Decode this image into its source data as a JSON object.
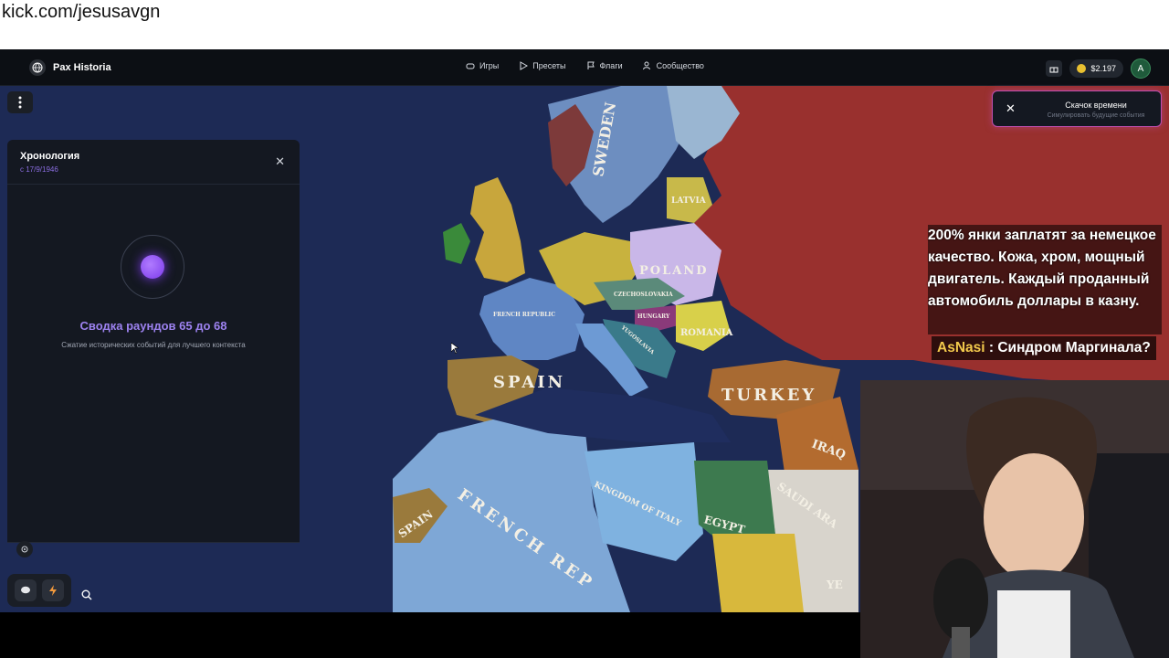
{
  "stream": {
    "url": "kick.com/jesusavgn"
  },
  "header": {
    "brand": "Pax Historia",
    "nav": [
      {
        "label": "Игры",
        "icon": "gamepad-icon"
      },
      {
        "label": "Пресеты",
        "icon": "play-icon"
      },
      {
        "label": "Флаги",
        "icon": "flag-icon"
      },
      {
        "label": "Сообщество",
        "icon": "users-icon"
      }
    ],
    "balance": "$2.197",
    "avatar": "A"
  },
  "timeline": {
    "title": "Хронология",
    "date": "с 17/9/1946",
    "summary": "Сводка раундов 65 до 68",
    "subtitle": "Сжатие исторических событий для лучшего контекста"
  },
  "timeleap": {
    "title": "Скачок времени",
    "subtitle": "Симулировать будущие события"
  },
  "overlay": {
    "donation": "200% янки заплатят за немецкое качество. Кожа, хром, мощный двигатель. Каждый проданный автомобиль доллары в казну.",
    "chat_user": "AsNasi",
    "chat_sep": " : ",
    "chat_text": "Синдром Маргинала?"
  },
  "map": {
    "labels": [
      "SWEDEN",
      "LATVIA",
      "POLAND",
      "FRENCH REPUBLIC",
      "CZECHOSLOVAKIA",
      "HUNGARY",
      "ROMANIA",
      "YUGOSLAVIA",
      "SPAIN",
      "TURKEY",
      "IRAQ",
      "KINGDOM OF ITALY",
      "EGYPT",
      "SAUDI ARA",
      "FRENCH REP",
      "SPAIN",
      "YE"
    ],
    "colors": {
      "ocean": "#1d2a55",
      "ussr": "#a0302c",
      "france": "#6b8fc6",
      "spain": "#9a7a3c",
      "turkey": "#a86a32",
      "poland": "#c9b7e8",
      "romania": "#d8d04a",
      "italy_africa": "#7fb2e0",
      "egypt": "#3d7a4f"
    }
  }
}
